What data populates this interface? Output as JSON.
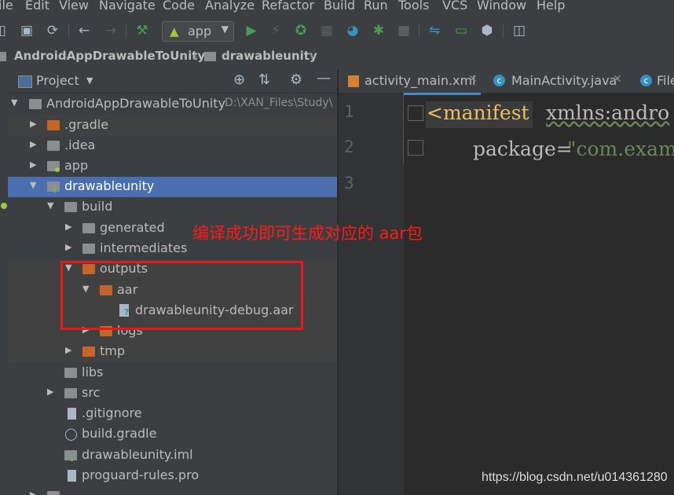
{
  "menu": [
    "ile",
    "Edit",
    "View",
    "Navigate",
    "Code",
    "Analyze",
    "Refactor",
    "Build",
    "Run",
    "Tools",
    "VCS",
    "Window",
    "Help"
  ],
  "toolbar": {
    "run_config": "app"
  },
  "breadcrumb": [
    "AndroidAppDrawableToUnity",
    "drawableunity"
  ],
  "panel": {
    "title": "Project"
  },
  "tree": [
    {
      "label": "AndroidAppDrawableToUnity",
      "path": "D:\\XAN_Files\\Study\\"
    },
    {
      "label": ".gradle"
    },
    {
      "label": ".idea"
    },
    {
      "label": "app"
    },
    {
      "label": "drawableunity"
    },
    {
      "label": "build"
    },
    {
      "label": "generated"
    },
    {
      "label": "intermediates"
    },
    {
      "label": "outputs"
    },
    {
      "label": "aar"
    },
    {
      "label": "drawableunity-debug.aar"
    },
    {
      "label": "logs"
    },
    {
      "label": "tmp"
    },
    {
      "label": "libs"
    },
    {
      "label": "src"
    },
    {
      "label": ".gitignore"
    },
    {
      "label": "build.gradle"
    },
    {
      "label": "drawableunity.iml"
    },
    {
      "label": "proguard-rules.pro"
    }
  ],
  "tabs": [
    "activity_main.xml",
    "MainActivity.java",
    "File"
  ],
  "editor": {
    "line_numbers": [
      "1",
      "2",
      "3"
    ],
    "line1_tag": "<manifest",
    "line1_attr": "xmlns:andro",
    "line2_attr": "package=",
    "line2_value": "\"com.exam"
  },
  "annotation": "编译成功即可生成对应的 aar包",
  "watermark": "https://blog.csdn.net/u014361280",
  "colors": {
    "selection": "#4b6eaf",
    "folder_orange": "#c5652a",
    "run_green": "#499c54",
    "annotation_red": "#ff1a1a",
    "tag_yellow": "#e8bf6a"
  }
}
